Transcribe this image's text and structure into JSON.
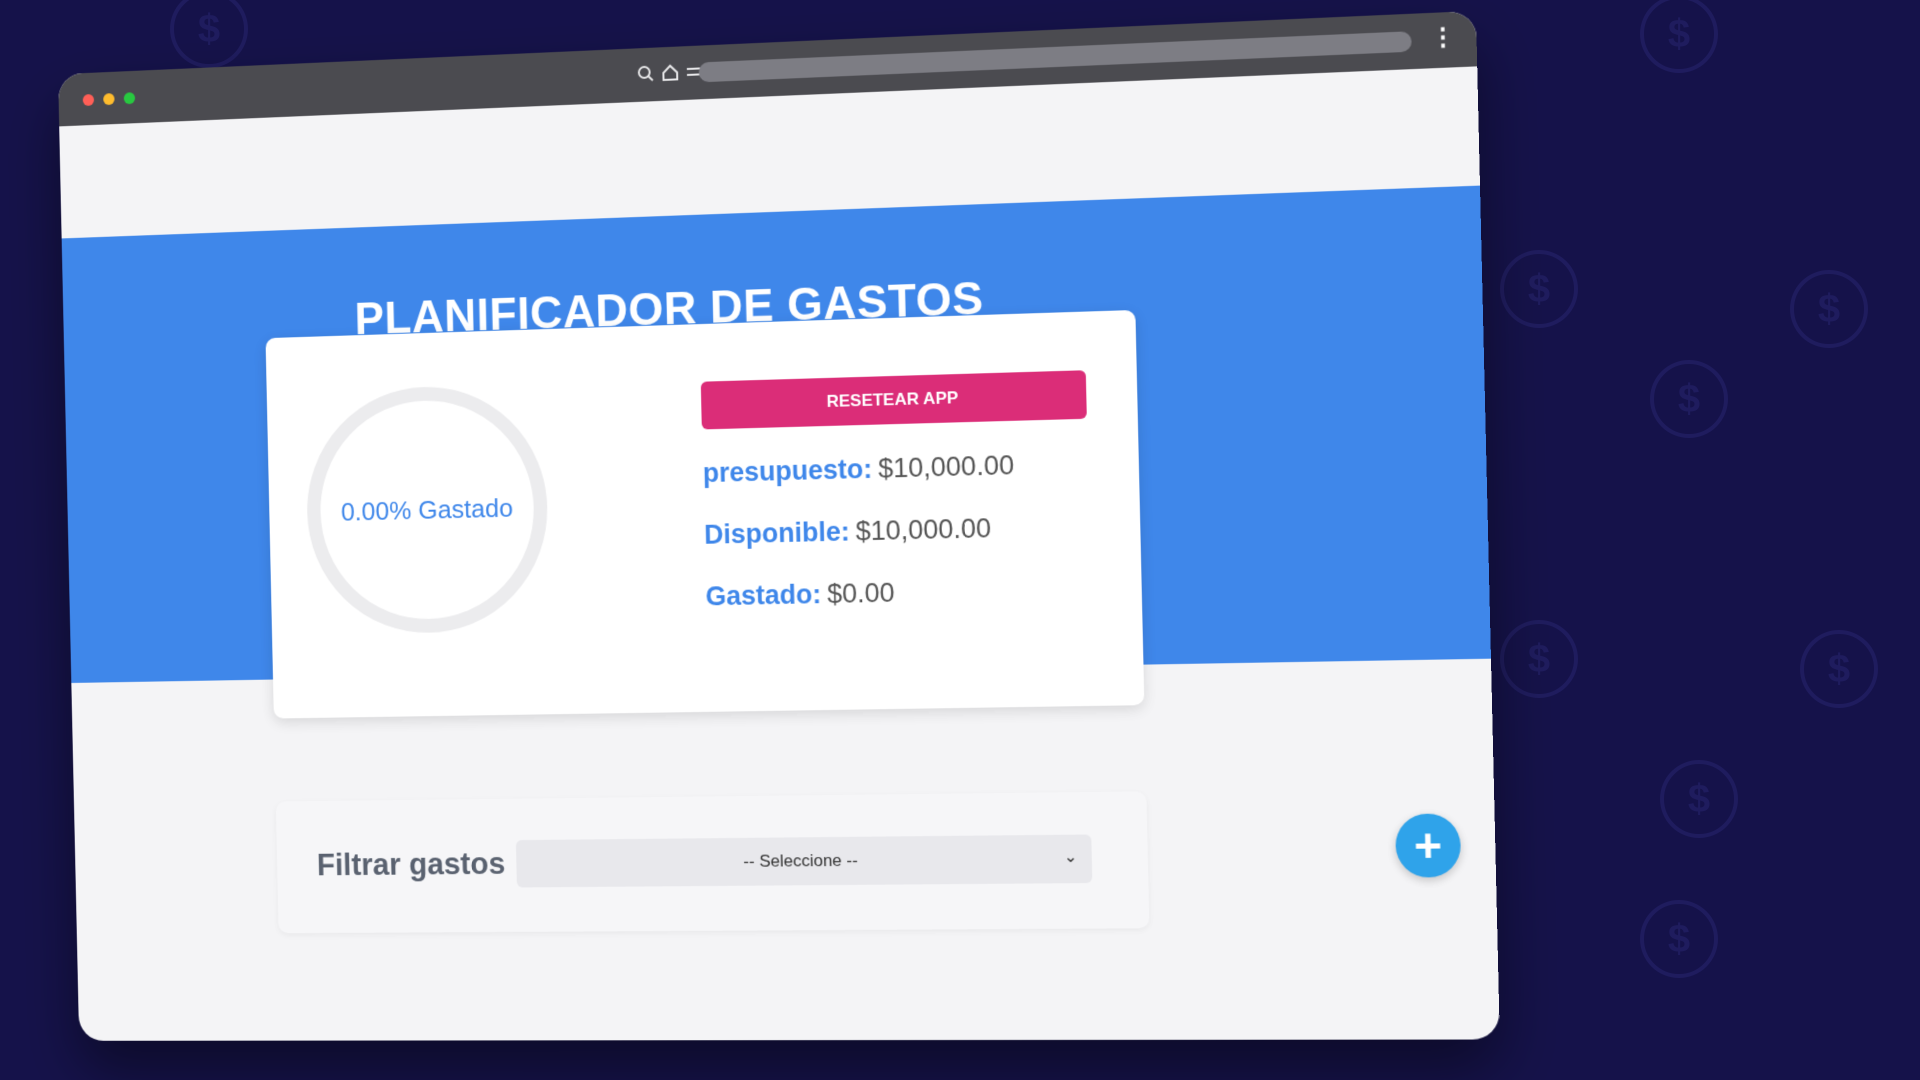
{
  "browser": {
    "icons": [
      "search-icon",
      "home-icon",
      "tune-icon",
      "more-vertical-icon"
    ],
    "kebab": "⋮"
  },
  "app": {
    "title": "PLANIFICADOR DE GASTOS",
    "progress": {
      "percent_text": "0.00% Gastado",
      "fraction_spent": 0
    },
    "reset_button": "RESETEAR APP",
    "stats": {
      "budget_label": "presupuesto:",
      "budget_value": "$10,000.00",
      "available_label": "Disponible:",
      "available_value": "$10,000.00",
      "spent_label": "Gastado:",
      "spent_value": "$0.00"
    },
    "filter": {
      "label": "Filtrar gastos",
      "selected": "-- Seleccione --"
    },
    "add_button": "+"
  },
  "colors": {
    "accent": "#3f87ea",
    "reset": "#db2d78",
    "add": "#2fa3ea",
    "backdrop": "#15124a"
  }
}
